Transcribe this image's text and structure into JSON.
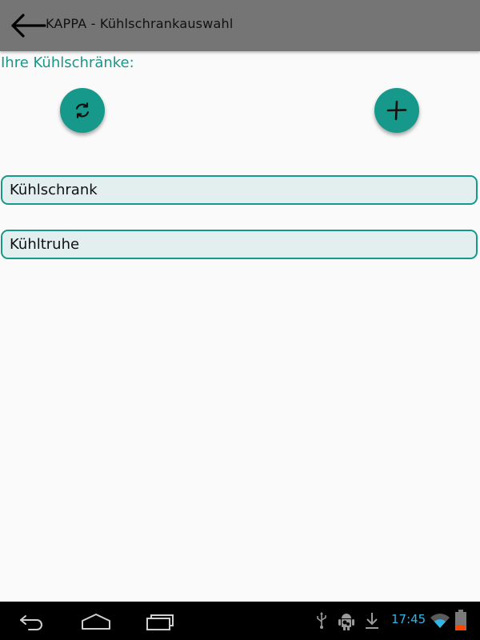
{
  "appbar": {
    "title": "KAPPA - Kühlschrankauswahl",
    "back_icon": "arrow-left-icon"
  },
  "section_label": "Ihre Kühlschränke:",
  "actions": {
    "refresh_icon": "refresh-icon",
    "add_icon": "plus-icon"
  },
  "fridges": [
    {
      "label": "Kühlschrank"
    },
    {
      "label": "Kühltruhe"
    }
  ],
  "system_bar": {
    "time": "17:45",
    "nav_icons": [
      "back-icon",
      "home-icon",
      "recents-icon"
    ],
    "status_icons": [
      "usb-icon",
      "android-debug-icon",
      "download-icon",
      "wifi-icon",
      "battery-icon"
    ]
  },
  "colors": {
    "accent": "#16998a",
    "appbar": "#757575",
    "clock": "#33b5e5",
    "battery_low": "#ff4400"
  }
}
